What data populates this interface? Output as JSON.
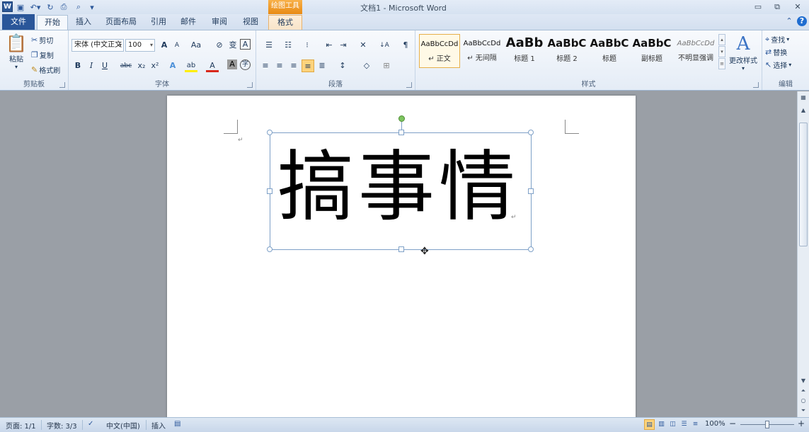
{
  "window": {
    "title": "文档1 - Microsoft Word",
    "context_tab_group": "绘图工具",
    "quick_access": [
      "W",
      "save-icon",
      "undo-icon",
      "redo-icon",
      "print-icon",
      "preview-icon",
      "customize-icon"
    ],
    "controls": [
      "▭",
      "⧉",
      "✕"
    ]
  },
  "tabs": {
    "file": "文件",
    "items": [
      "开始",
      "插入",
      "页面布局",
      "引用",
      "邮件",
      "审阅",
      "视图"
    ],
    "context": "格式",
    "active": "开始",
    "right_icons": [
      "⌃",
      "?"
    ]
  },
  "ribbon": {
    "clipboard": {
      "label": "剪贴板",
      "paste": "粘贴",
      "cut": "剪切",
      "copy": "复制",
      "format_painter": "格式刷"
    },
    "font": {
      "label": "字体",
      "font_name": "宋体 (中文正文",
      "font_size": "100",
      "grow": "A",
      "shrink": "A",
      "change_case": "Aa",
      "clear": "⊘",
      "phonetic": "变",
      "border": "A",
      "bold": "B",
      "italic": "I",
      "underline": "U",
      "strike": "abc",
      "subscript": "x₂",
      "superscript": "x²",
      "text_effects": "A",
      "highlight": "ab",
      "font_color": "A",
      "shading": "A",
      "enclose": "字"
    },
    "paragraph": {
      "label": "段落",
      "bullets": "☰",
      "numbering": "☷",
      "multilevel": "⁝",
      "decrease_indent": "⇤",
      "increase_indent": "⇥",
      "chinese_layout": "✕",
      "sort": "↓A",
      "show_marks": "¶",
      "align_left": "≡",
      "center": "≡",
      "align_right": "≡",
      "justify": "≡",
      "distribute": "≣",
      "line_spacing": "↕",
      "shading": "◇",
      "borders": "⊞"
    },
    "styles": {
      "label": "样式",
      "items": [
        {
          "preview": "AaBbCcDd",
          "name": "↵ 正文"
        },
        {
          "preview": "AaBbCcDd",
          "name": "↵ 无间隔"
        },
        {
          "preview": "AaBb",
          "name": "标题 1"
        },
        {
          "preview": "AaBbC",
          "name": "标题 2"
        },
        {
          "preview": "AaBbC",
          "name": "标题"
        },
        {
          "preview": "AaBbC",
          "name": "副标题"
        },
        {
          "preview": "AaBbCcDd",
          "name": "不明显强调"
        }
      ],
      "change_styles": "更改样式",
      "change_styles_icon": "A"
    },
    "editing": {
      "label": "编辑",
      "find": "查找",
      "replace": "替换",
      "select": "选择"
    }
  },
  "document": {
    "textbox_text": "搞事情",
    "paragraph_mark": "↵"
  },
  "statusbar": {
    "page": "页面: 1/1",
    "words": "字数: 3/3",
    "language": "中文(中国)",
    "mode": "插入",
    "zoom": "100%",
    "zoom_minus": "−",
    "zoom_plus": "+",
    "zoom_level": 0.5
  },
  "colors": {
    "accent": "#2a5699",
    "context_tab": "#e88a13",
    "selected_style": "#fcd37c"
  }
}
